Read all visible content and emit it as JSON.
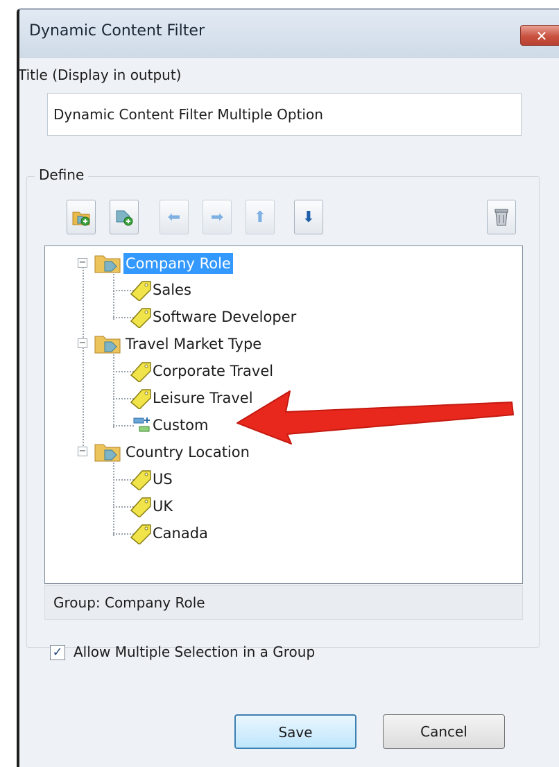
{
  "window": {
    "title": "Dynamic Content Filter",
    "close_label": "✕"
  },
  "title_field": {
    "label": "Title (Display in output)",
    "value": "Dynamic Content Filter Multiple Option"
  },
  "define": {
    "legend": "Define",
    "toolbar": [
      {
        "name": "add-group-button",
        "icon": "folder-tag-add-icon",
        "enabled": true
      },
      {
        "name": "add-tag-button",
        "icon": "tag-add-icon",
        "enabled": true
      },
      {
        "name": "move-left-button",
        "icon": "arrow-left-icon",
        "glyph": "⬅",
        "enabled": false
      },
      {
        "name": "move-right-button",
        "icon": "arrow-right-icon",
        "glyph": "➡",
        "enabled": false
      },
      {
        "name": "move-up-button",
        "icon": "arrow-up-icon",
        "glyph": "⬆",
        "enabled": false
      },
      {
        "name": "move-down-button",
        "icon": "arrow-down-icon",
        "glyph": "⬇",
        "enabled": true
      },
      {
        "name": "delete-button",
        "icon": "trash-icon",
        "enabled": true
      }
    ],
    "tree": {
      "groups": [
        {
          "label": "Company Role",
          "selected": true,
          "children": [
            "Sales",
            "Software Developer"
          ]
        },
        {
          "label": "Travel Market Type",
          "selected": false,
          "children": [
            "Corporate Travel",
            "Leisure Travel"
          ],
          "custom": "Custom"
        },
        {
          "label": "Country Location",
          "selected": false,
          "children": [
            "US",
            "UK",
            "Canada"
          ]
        }
      ]
    },
    "status": "Group: Company Role"
  },
  "allow_multiple": {
    "label": "Allow Multiple Selection in a Group",
    "checked": true
  },
  "buttons": {
    "save": "Save",
    "cancel": "Cancel"
  },
  "colors": {
    "selection": "#3399ff",
    "tag": "#f0e44a",
    "annotation_arrow": "#e8281c"
  }
}
